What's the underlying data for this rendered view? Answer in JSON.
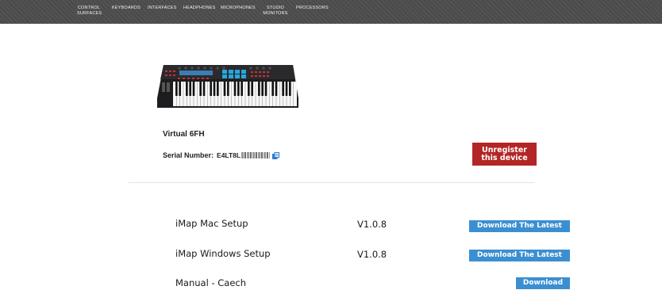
{
  "nav": {
    "items": [
      {
        "line1": "CONTROL",
        "line2": "SURFACES"
      },
      {
        "line1": "KEYBOARDS",
        "line2": ""
      },
      {
        "line1": "INTERFACES",
        "line2": ""
      },
      {
        "line1": "HEADPHONES",
        "line2": ""
      },
      {
        "line1": "MICROPHONES",
        "line2": ""
      },
      {
        "line1": "STUDIO",
        "line2": "MONITORS"
      },
      {
        "line1": "PROCESSORS",
        "line2": ""
      }
    ]
  },
  "device": {
    "name": "Virtual 6FH",
    "serial_label": "Serial Number:",
    "serial_value": "E4LT8L",
    "unregister_label_1": "Unregister",
    "unregister_label_2": "this device",
    "unregister_color": "#b42525"
  },
  "downloads": [
    {
      "label": "iMap Mac Setup",
      "version": "V1.0.8",
      "button": "Download The Latest"
    },
    {
      "label": "iMap Windows Setup",
      "version": "V1.0.8",
      "button": "Download The Latest"
    },
    {
      "label": "Manual - Caech",
      "version": "",
      "button": "Download"
    }
  ],
  "colors": {
    "nav_bg": "#4a4a4a",
    "download_button": "#3b8fd1"
  },
  "icons": {
    "copy": "copy-icon"
  }
}
